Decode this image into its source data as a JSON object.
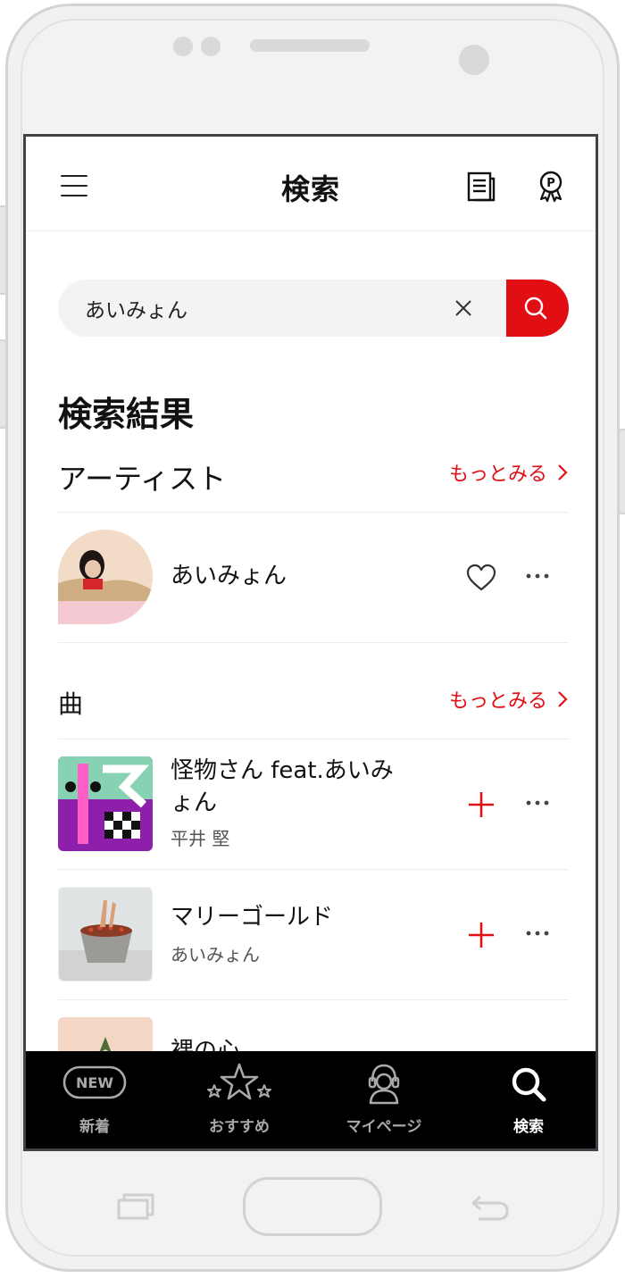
{
  "header": {
    "title": "検索",
    "menu_icon": "hamburger-icon",
    "news_icon": "news-icon",
    "points_icon": "points-badge-icon"
  },
  "search": {
    "value": "あいみょん",
    "clear_icon": "close-icon",
    "submit_icon": "search-icon"
  },
  "results": {
    "title": "検索結果"
  },
  "artists": {
    "title": "アーティスト",
    "more_label": "もっとみる",
    "items": [
      {
        "name": "あいみょん",
        "favorite_icon": "heart-outline-icon",
        "more_icon": "ellipsis-icon"
      }
    ]
  },
  "songs": {
    "title": "曲",
    "more_label": "もっとみる",
    "items": [
      {
        "title": "怪物さん feat.あいみょん",
        "artist": "平井 堅",
        "add_icon": "plus-icon",
        "more_icon": "ellipsis-icon"
      },
      {
        "title": "マリーゴールド",
        "artist": "あいみょん",
        "add_icon": "plus-icon",
        "more_icon": "ellipsis-icon"
      },
      {
        "title": "裸の心",
        "artist": ""
      }
    ]
  },
  "bottom_nav": {
    "items": [
      {
        "label": "新着",
        "icon": "new-badge-icon",
        "active": false
      },
      {
        "label": "おすすめ",
        "icon": "stars-icon",
        "active": false
      },
      {
        "label": "マイページ",
        "icon": "user-headphones-icon",
        "active": false
      },
      {
        "label": "検索",
        "icon": "search-icon",
        "active": true
      }
    ],
    "new_badge_text": "NEW"
  },
  "colors": {
    "accent": "#e10f14",
    "nav_background": "#000000",
    "nav_inactive": "#a9a9a9",
    "nav_active": "#ffffff"
  }
}
